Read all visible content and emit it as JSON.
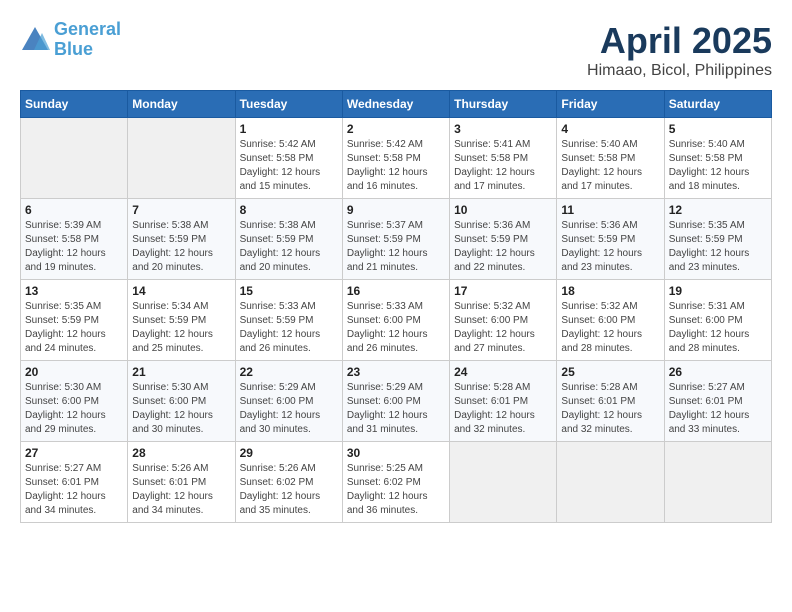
{
  "header": {
    "logo_line1": "General",
    "logo_line2": "Blue",
    "month": "April 2025",
    "location": "Himaao, Bicol, Philippines"
  },
  "weekdays": [
    "Sunday",
    "Monday",
    "Tuesday",
    "Wednesday",
    "Thursday",
    "Friday",
    "Saturday"
  ],
  "weeks": [
    [
      null,
      null,
      {
        "day": 1,
        "sunrise": "5:42 AM",
        "sunset": "5:58 PM",
        "daylight": "12 hours and 15 minutes."
      },
      {
        "day": 2,
        "sunrise": "5:42 AM",
        "sunset": "5:58 PM",
        "daylight": "12 hours and 16 minutes."
      },
      {
        "day": 3,
        "sunrise": "5:41 AM",
        "sunset": "5:58 PM",
        "daylight": "12 hours and 17 minutes."
      },
      {
        "day": 4,
        "sunrise": "5:40 AM",
        "sunset": "5:58 PM",
        "daylight": "12 hours and 17 minutes."
      },
      {
        "day": 5,
        "sunrise": "5:40 AM",
        "sunset": "5:58 PM",
        "daylight": "12 hours and 18 minutes."
      }
    ],
    [
      {
        "day": 6,
        "sunrise": "5:39 AM",
        "sunset": "5:58 PM",
        "daylight": "12 hours and 19 minutes."
      },
      {
        "day": 7,
        "sunrise": "5:38 AM",
        "sunset": "5:59 PM",
        "daylight": "12 hours and 20 minutes."
      },
      {
        "day": 8,
        "sunrise": "5:38 AM",
        "sunset": "5:59 PM",
        "daylight": "12 hours and 20 minutes."
      },
      {
        "day": 9,
        "sunrise": "5:37 AM",
        "sunset": "5:59 PM",
        "daylight": "12 hours and 21 minutes."
      },
      {
        "day": 10,
        "sunrise": "5:36 AM",
        "sunset": "5:59 PM",
        "daylight": "12 hours and 22 minutes."
      },
      {
        "day": 11,
        "sunrise": "5:36 AM",
        "sunset": "5:59 PM",
        "daylight": "12 hours and 23 minutes."
      },
      {
        "day": 12,
        "sunrise": "5:35 AM",
        "sunset": "5:59 PM",
        "daylight": "12 hours and 23 minutes."
      }
    ],
    [
      {
        "day": 13,
        "sunrise": "5:35 AM",
        "sunset": "5:59 PM",
        "daylight": "12 hours and 24 minutes."
      },
      {
        "day": 14,
        "sunrise": "5:34 AM",
        "sunset": "5:59 PM",
        "daylight": "12 hours and 25 minutes."
      },
      {
        "day": 15,
        "sunrise": "5:33 AM",
        "sunset": "5:59 PM",
        "daylight": "12 hours and 26 minutes."
      },
      {
        "day": 16,
        "sunrise": "5:33 AM",
        "sunset": "6:00 PM",
        "daylight": "12 hours and 26 minutes."
      },
      {
        "day": 17,
        "sunrise": "5:32 AM",
        "sunset": "6:00 PM",
        "daylight": "12 hours and 27 minutes."
      },
      {
        "day": 18,
        "sunrise": "5:32 AM",
        "sunset": "6:00 PM",
        "daylight": "12 hours and 28 minutes."
      },
      {
        "day": 19,
        "sunrise": "5:31 AM",
        "sunset": "6:00 PM",
        "daylight": "12 hours and 28 minutes."
      }
    ],
    [
      {
        "day": 20,
        "sunrise": "5:30 AM",
        "sunset": "6:00 PM",
        "daylight": "12 hours and 29 minutes."
      },
      {
        "day": 21,
        "sunrise": "5:30 AM",
        "sunset": "6:00 PM",
        "daylight": "12 hours and 30 minutes."
      },
      {
        "day": 22,
        "sunrise": "5:29 AM",
        "sunset": "6:00 PM",
        "daylight": "12 hours and 30 minutes."
      },
      {
        "day": 23,
        "sunrise": "5:29 AM",
        "sunset": "6:00 PM",
        "daylight": "12 hours and 31 minutes."
      },
      {
        "day": 24,
        "sunrise": "5:28 AM",
        "sunset": "6:01 PM",
        "daylight": "12 hours and 32 minutes."
      },
      {
        "day": 25,
        "sunrise": "5:28 AM",
        "sunset": "6:01 PM",
        "daylight": "12 hours and 32 minutes."
      },
      {
        "day": 26,
        "sunrise": "5:27 AM",
        "sunset": "6:01 PM",
        "daylight": "12 hours and 33 minutes."
      }
    ],
    [
      {
        "day": 27,
        "sunrise": "5:27 AM",
        "sunset": "6:01 PM",
        "daylight": "12 hours and 34 minutes."
      },
      {
        "day": 28,
        "sunrise": "5:26 AM",
        "sunset": "6:01 PM",
        "daylight": "12 hours and 34 minutes."
      },
      {
        "day": 29,
        "sunrise": "5:26 AM",
        "sunset": "6:02 PM",
        "daylight": "12 hours and 35 minutes."
      },
      {
        "day": 30,
        "sunrise": "5:25 AM",
        "sunset": "6:02 PM",
        "daylight": "12 hours and 36 minutes."
      },
      null,
      null,
      null
    ]
  ]
}
